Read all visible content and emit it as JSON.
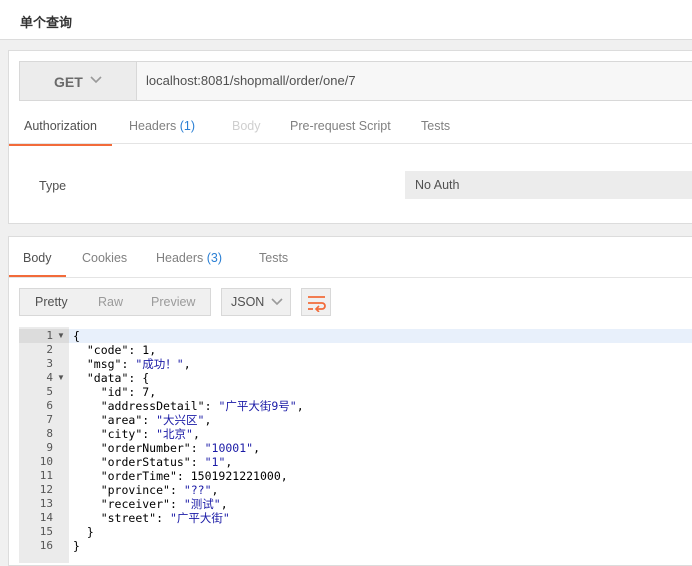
{
  "title": "单个查询",
  "request": {
    "method": "GET",
    "url": "localhost:8081/shopmall/order/one/7",
    "tabs": [
      {
        "label": "Authorization",
        "count": "",
        "state": "active"
      },
      {
        "label": "Headers",
        "count": "(1)",
        "state": "normal"
      },
      {
        "label": "Body",
        "count": "",
        "state": "disabled"
      },
      {
        "label": "Pre-request Script",
        "count": "",
        "state": "normal"
      },
      {
        "label": "Tests",
        "count": "",
        "state": "normal"
      }
    ],
    "auth": {
      "type_label": "Type",
      "type_value": "No Auth"
    }
  },
  "response": {
    "tabs": [
      {
        "label": "Body",
        "count": ""
      },
      {
        "label": "Cookies",
        "count": ""
      },
      {
        "label": "Headers",
        "count": "(3)"
      },
      {
        "label": "Tests",
        "count": ""
      }
    ],
    "views": [
      "Pretty",
      "Raw",
      "Preview"
    ],
    "format": "JSON",
    "lines": [
      {
        "n": "1",
        "fold": true,
        "text": "{"
      },
      {
        "n": "2",
        "fold": false,
        "text": "  \"code\": 1,"
      },
      {
        "n": "3",
        "fold": false,
        "text": "  \"msg\": \"成功！\","
      },
      {
        "n": "4",
        "fold": true,
        "text": "  \"data\": {"
      },
      {
        "n": "5",
        "fold": false,
        "text": "    \"id\": 7,"
      },
      {
        "n": "6",
        "fold": false,
        "text": "    \"addressDetail\": \"广平大街9号\","
      },
      {
        "n": "7",
        "fold": false,
        "text": "    \"area\": \"大兴区\","
      },
      {
        "n": "8",
        "fold": false,
        "text": "    \"city\": \"北京\","
      },
      {
        "n": "9",
        "fold": false,
        "text": "    \"orderNumber\": \"10001\","
      },
      {
        "n": "10",
        "fold": false,
        "text": "    \"orderStatus\": \"1\","
      },
      {
        "n": "11",
        "fold": false,
        "text": "    \"orderTime\": 1501921221000,"
      },
      {
        "n": "12",
        "fold": false,
        "text": "    \"province\": \"??\","
      },
      {
        "n": "13",
        "fold": false,
        "text": "    \"receiver\": \"测试\","
      },
      {
        "n": "14",
        "fold": false,
        "text": "    \"street\": \"广平大街\""
      },
      {
        "n": "15",
        "fold": false,
        "text": "  }"
      },
      {
        "n": "16",
        "fold": false,
        "text": "}"
      }
    ]
  }
}
